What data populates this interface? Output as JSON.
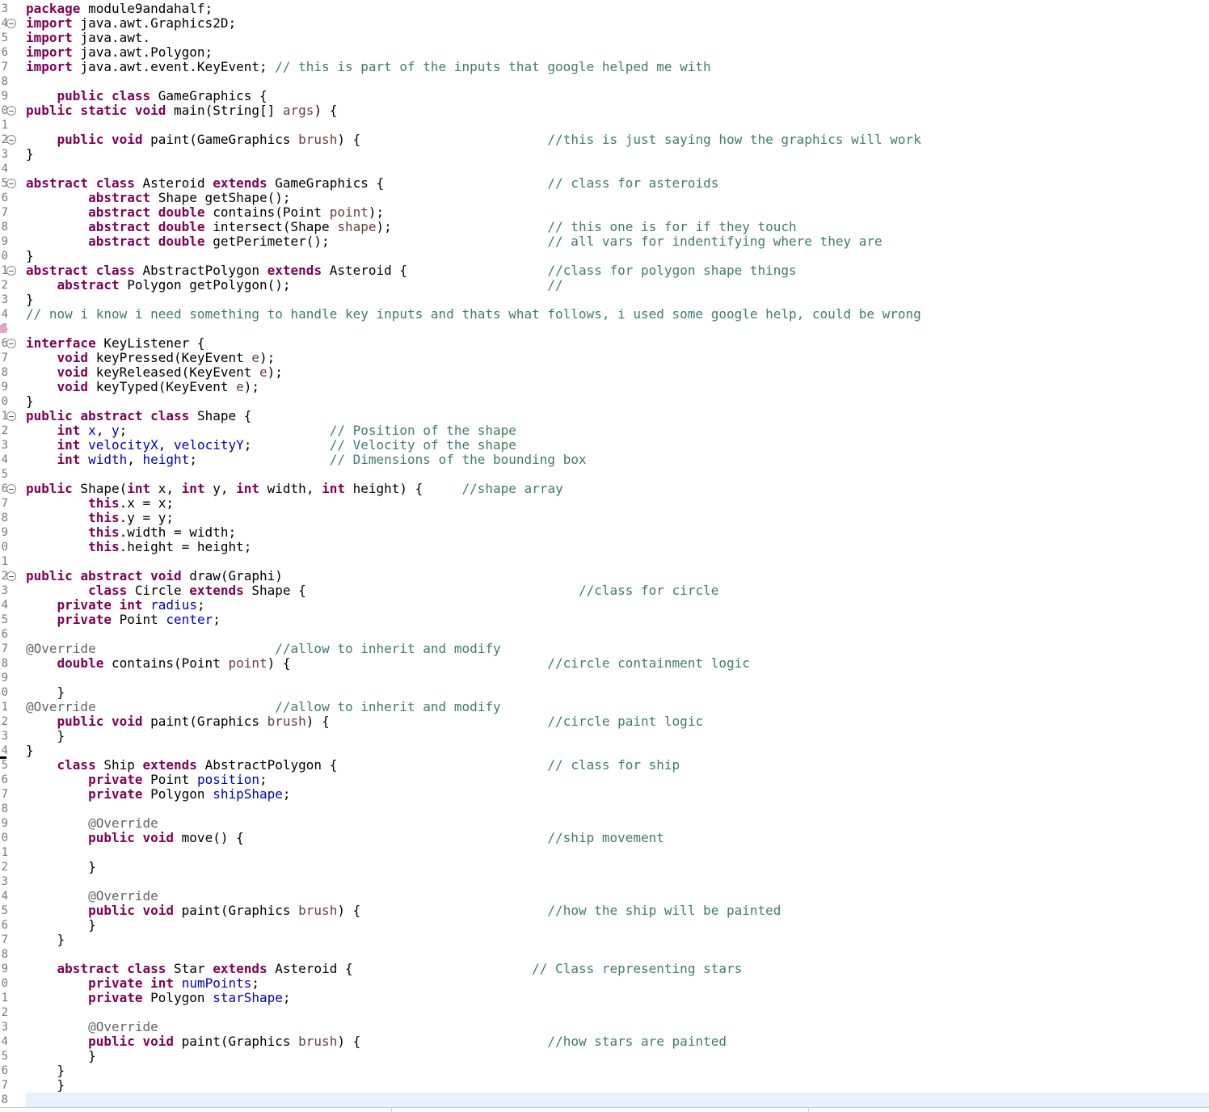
{
  "editor": {
    "language": "java",
    "lines": [
      {
        "n": "3",
        "fold": false,
        "code": "package module9andahalf;"
      },
      {
        "n": "4",
        "fold": true,
        "code": "import java.awt.Graphics2D;"
      },
      {
        "n": "5",
        "fold": false,
        "code": "import java.awt."
      },
      {
        "n": "6",
        "fold": false,
        "code": "import java.awt.Polygon;"
      },
      {
        "n": "7",
        "fold": false,
        "code": "import java.awt.event.KeyEvent; // this is part of the inputs that google helped me with"
      },
      {
        "n": "8",
        "fold": false,
        "code": ""
      },
      {
        "n": "9",
        "fold": false,
        "code": "    public class GameGraphics {"
      },
      {
        "n": "0",
        "fold": true,
        "code": "public static void main(String[] args) {"
      },
      {
        "n": "1",
        "fold": false,
        "code": ""
      },
      {
        "n": "2",
        "fold": true,
        "code": "    public void paint(GameGraphics brush) {                        //this is just saying how the graphics will work"
      },
      {
        "n": "3",
        "fold": false,
        "code": "}"
      },
      {
        "n": "4",
        "fold": false,
        "code": ""
      },
      {
        "n": "5",
        "fold": true,
        "code": "abstract class Asteroid extends GameGraphics {                     // class for asteroids"
      },
      {
        "n": "6",
        "fold": false,
        "code": "        abstract Shape getShape();"
      },
      {
        "n": "7",
        "fold": false,
        "code": "        abstract double contains(Point point);"
      },
      {
        "n": "8",
        "fold": false,
        "code": "        abstract double intersect(Shape shape);                    // this one is for if they touch"
      },
      {
        "n": "9",
        "fold": false,
        "code": "        abstract double getPerimeter();                            // all vars for indentifying where they are"
      },
      {
        "n": "0",
        "fold": false,
        "code": "}"
      },
      {
        "n": "1",
        "fold": true,
        "code": "abstract class AbstractPolygon extends Asteroid {                  //class for polygon shape things"
      },
      {
        "n": "2",
        "fold": false,
        "code": "    abstract Polygon getPolygon();                                 //"
      },
      {
        "n": "3",
        "fold": false,
        "code": "}"
      },
      {
        "n": "4",
        "fold": false,
        "code": "// now i know i need something to handle key inputs and thats what follows, i used some google help, could be wrong"
      },
      {
        "n": "5",
        "fold": false,
        "code": ""
      },
      {
        "n": "6",
        "fold": true,
        "code": "interface KeyListener {"
      },
      {
        "n": "7",
        "fold": false,
        "code": "    void keyPressed(KeyEvent e);"
      },
      {
        "n": "8",
        "fold": false,
        "code": "    void keyReleased(KeyEvent e);"
      },
      {
        "n": "9",
        "fold": false,
        "code": "    void keyTyped(KeyEvent e);"
      },
      {
        "n": "0",
        "fold": false,
        "code": "}"
      },
      {
        "n": "1",
        "fold": true,
        "code": "public abstract class Shape {"
      },
      {
        "n": "2",
        "fold": false,
        "code": "    int x, y;                          // Position of the shape"
      },
      {
        "n": "3",
        "fold": false,
        "code": "    int velocityX, velocityY;          // Velocity of the shape"
      },
      {
        "n": "4",
        "fold": false,
        "code": "    int width, height;                 // Dimensions of the bounding box"
      },
      {
        "n": "5",
        "fold": false,
        "code": ""
      },
      {
        "n": "6",
        "fold": true,
        "code": "public Shape(int x, int y, int width, int height) {     //shape array"
      },
      {
        "n": "7",
        "fold": false,
        "code": "        this.x = x;"
      },
      {
        "n": "8",
        "fold": false,
        "code": "        this.y = y;"
      },
      {
        "n": "9",
        "fold": false,
        "code": "        this.width = width;"
      },
      {
        "n": "0",
        "fold": false,
        "code": "        this.height = height;"
      },
      {
        "n": "1",
        "fold": false,
        "code": ""
      },
      {
        "n": "2",
        "fold": true,
        "code": "public abstract void draw(Graphi)"
      },
      {
        "n": "3",
        "fold": false,
        "code": "        class Circle extends Shape {                                   //class for circle"
      },
      {
        "n": "4",
        "fold": false,
        "code": "    private int radius;"
      },
      {
        "n": "5",
        "fold": false,
        "code": "    private Point center;"
      },
      {
        "n": "6",
        "fold": false,
        "code": ""
      },
      {
        "n": "7",
        "fold": false,
        "code": "@Override                       //allow to inherit and modify"
      },
      {
        "n": "8",
        "fold": false,
        "code": "    double contains(Point point) {                                 //circle containment logic"
      },
      {
        "n": "9",
        "fold": false,
        "code": ""
      },
      {
        "n": "0",
        "fold": false,
        "code": "    }"
      },
      {
        "n": "1",
        "fold": false,
        "code": "@Override                       //allow to inherit and modify"
      },
      {
        "n": "2",
        "fold": false,
        "code": "    public void paint(Graphics brush) {                            //circle paint logic"
      },
      {
        "n": "3",
        "fold": false,
        "code": "    }"
      },
      {
        "n": "4",
        "fold": false,
        "code": "}"
      },
      {
        "n": "5",
        "fold": false,
        "code": "    class Ship extends AbstractPolygon {                           // class for ship"
      },
      {
        "n": "6",
        "fold": false,
        "code": "        private Point position;"
      },
      {
        "n": "7",
        "fold": false,
        "code": "        private Polygon shipShape;"
      },
      {
        "n": "8",
        "fold": false,
        "code": ""
      },
      {
        "n": "9",
        "fold": false,
        "code": "        @Override"
      },
      {
        "n": "0",
        "fold": false,
        "code": "        public void move() {                                       //ship movement"
      },
      {
        "n": "1",
        "fold": false,
        "code": ""
      },
      {
        "n": "2",
        "fold": false,
        "code": "        }"
      },
      {
        "n": "3",
        "fold": false,
        "code": ""
      },
      {
        "n": "4",
        "fold": false,
        "code": "        @Override"
      },
      {
        "n": "5",
        "fold": false,
        "code": "        public void paint(Graphics brush) {                        //how the ship will be painted"
      },
      {
        "n": "6",
        "fold": false,
        "code": "        }"
      },
      {
        "n": "7",
        "fold": false,
        "code": "    }"
      },
      {
        "n": "8",
        "fold": false,
        "code": ""
      },
      {
        "n": "9",
        "fold": false,
        "code": "    abstract class Star extends Asteroid {                       // Class representing stars"
      },
      {
        "n": "0",
        "fold": false,
        "code": "        private int numPoints;"
      },
      {
        "n": "1",
        "fold": false,
        "code": "        private Polygon starShape;"
      },
      {
        "n": "2",
        "fold": false,
        "code": ""
      },
      {
        "n": "3",
        "fold": false,
        "code": "        @Override"
      },
      {
        "n": "4",
        "fold": false,
        "code": "        public void paint(Graphics brush) {                        //how stars are painted"
      },
      {
        "n": "5",
        "fold": false,
        "code": "        }"
      },
      {
        "n": "6",
        "fold": false,
        "code": "    }"
      },
      {
        "n": "7",
        "fold": false,
        "code": "    }"
      },
      {
        "n": "8",
        "fold": false,
        "code": ""
      }
    ]
  },
  "colors": {
    "keyword": "#7f0055",
    "comment": "#3f7f5f",
    "field": "#0000c0",
    "parameter": "#6a3e3e",
    "annotation": "#646464",
    "current_line": "#e8f2fe"
  }
}
